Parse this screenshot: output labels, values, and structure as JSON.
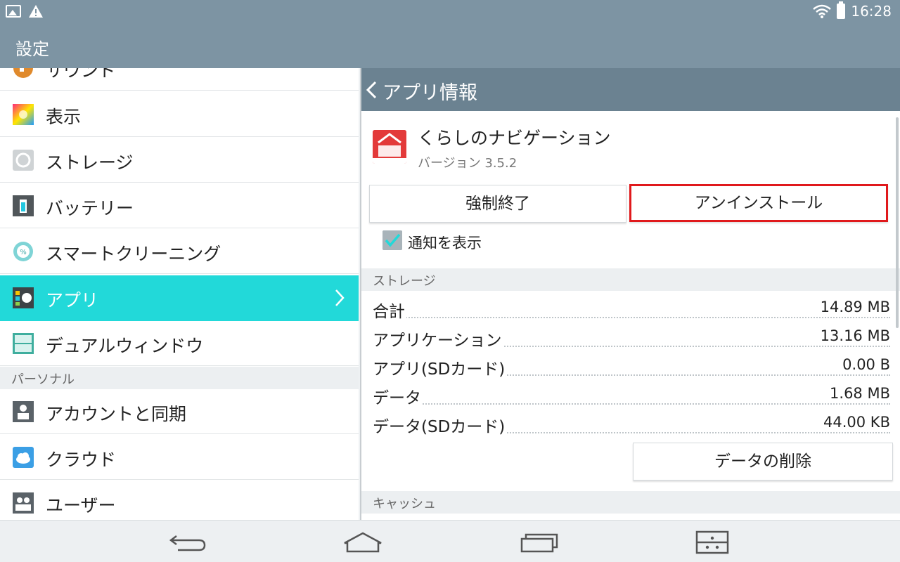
{
  "status_bar": {
    "time": "16:28",
    "icons": [
      "image-notification-icon",
      "warning-icon",
      "wifi-icon",
      "battery-icon"
    ]
  },
  "title_bar": {
    "title": "設定"
  },
  "sidebar": {
    "items": [
      {
        "label": "サウンド",
        "icon": "sound-icon"
      },
      {
        "label": "表示",
        "icon": "display-icon"
      },
      {
        "label": "ストレージ",
        "icon": "storage-icon"
      },
      {
        "label": "バッテリー",
        "icon": "battery-settings-icon"
      },
      {
        "label": "スマートクリーニング",
        "icon": "smart-cleaning-icon"
      },
      {
        "label": "アプリ",
        "icon": "apps-icon",
        "selected": true
      },
      {
        "label": "デュアルウィンドウ",
        "icon": "dual-window-icon"
      }
    ],
    "section_personal": "パーソナル",
    "personal_items": [
      {
        "label": "アカウントと同期",
        "icon": "account-sync-icon"
      },
      {
        "label": "クラウド",
        "icon": "cloud-icon"
      },
      {
        "label": "ユーザー",
        "icon": "users-icon"
      }
    ]
  },
  "app_info": {
    "header": "アプリ情報",
    "app_name": "くらしのナビゲーション",
    "version": "バージョン 3.5.2",
    "force_stop_label": "強制終了",
    "uninstall_label": "アンインストール",
    "show_notifications_label": "通知を表示",
    "show_notifications_checked": true,
    "storage_section": "ストレージ",
    "storage_rows": [
      {
        "key": "合計",
        "value": "14.89 MB"
      },
      {
        "key": "アプリケーション",
        "value": "13.16 MB"
      },
      {
        "key": "アプリ(SDカード)",
        "value": "0.00 B"
      },
      {
        "key": "データ",
        "value": "1.68 MB"
      },
      {
        "key": "データ(SDカード)",
        "value": "44.00 KB"
      }
    ],
    "clear_data_label": "データの削除",
    "cache_section": "キャッシュ"
  },
  "colors": {
    "header_bg": "#7d94a3",
    "selected_item": "#22d9d9",
    "highlight_border": "#e0191c"
  }
}
